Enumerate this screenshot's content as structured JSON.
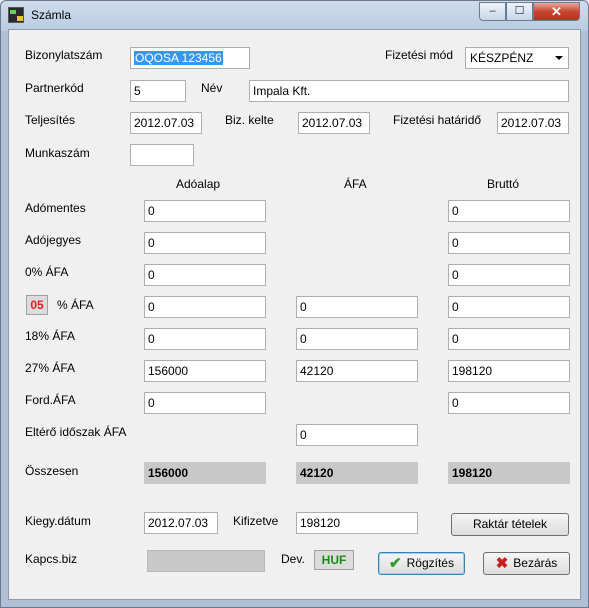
{
  "window": {
    "title": "Számla",
    "min_glyph": "–",
    "max_glyph": "☐",
    "close_glyph": "✕"
  },
  "form": {
    "bizonylatszam": {
      "label": "Bizonylatszám",
      "value": "OQOSA 123456"
    },
    "fizetesi_mod": {
      "label": "Fizetési mód",
      "value": "KÉSZPÉNZ"
    },
    "partnerkod": {
      "label": "Partnerkód",
      "value": "5"
    },
    "nev": {
      "label": "Név",
      "value": "Impala Kft."
    },
    "teljesites": {
      "label": "Teljesítés",
      "value": "2012.07.03"
    },
    "biz_kelte": {
      "label": "Biz. kelte",
      "value": "2012.07.03"
    },
    "fizetesi_hatarido": {
      "label": "Fizetési határidő",
      "value": "2012.07.03"
    },
    "munkaszam": {
      "label": "Munkaszám",
      "value": ""
    }
  },
  "table": {
    "headers": {
      "adoalap": "Adóalap",
      "afa": "ÁFA",
      "brutto": "Bruttó"
    },
    "rows": {
      "adomentes": {
        "label": "Adómentes",
        "adoalap": "0",
        "brutto": "0"
      },
      "adojegyes": {
        "label": "Adójegyes",
        "adoalap": "0",
        "brutto": "0"
      },
      "afa0": {
        "label": "0% ÁFA",
        "adoalap": "0",
        "brutto": "0"
      },
      "afa_custom": {
        "rate": "05",
        "label": "% ÁFA",
        "adoalap": "0",
        "afa": "0",
        "brutto": "0"
      },
      "afa18": {
        "label": "18% ÁFA",
        "adoalap": "0",
        "afa": "0",
        "brutto": "0"
      },
      "afa27": {
        "label": "27% ÁFA",
        "adoalap": "156000",
        "afa": "42120",
        "brutto": "198120"
      },
      "ford_afa": {
        "label": "Ford.ÁFA",
        "adoalap": "0",
        "brutto": "0"
      },
      "eltero": {
        "label": "Eltérő időszak ÁFA",
        "afa": "0"
      }
    },
    "total": {
      "label": "Összesen",
      "adoalap": "156000",
      "afa": "42120",
      "brutto": "198120"
    }
  },
  "footer": {
    "kiegy_datum": {
      "label": "Kiegy.dátum",
      "value": "2012.07.03"
    },
    "kifizetve": {
      "label": "Kifizetve",
      "value": "198120"
    },
    "raktar_button": "Raktár tételek",
    "kapcs_biz": {
      "label": "Kapcs.biz",
      "value": ""
    },
    "dev": {
      "label": "Dev.",
      "value": "HUF"
    },
    "rogzites_button": "Rögzítés",
    "bezaras_button": "Bezárás",
    "rogzites_icon": "✔",
    "bezaras_icon": "✖"
  }
}
